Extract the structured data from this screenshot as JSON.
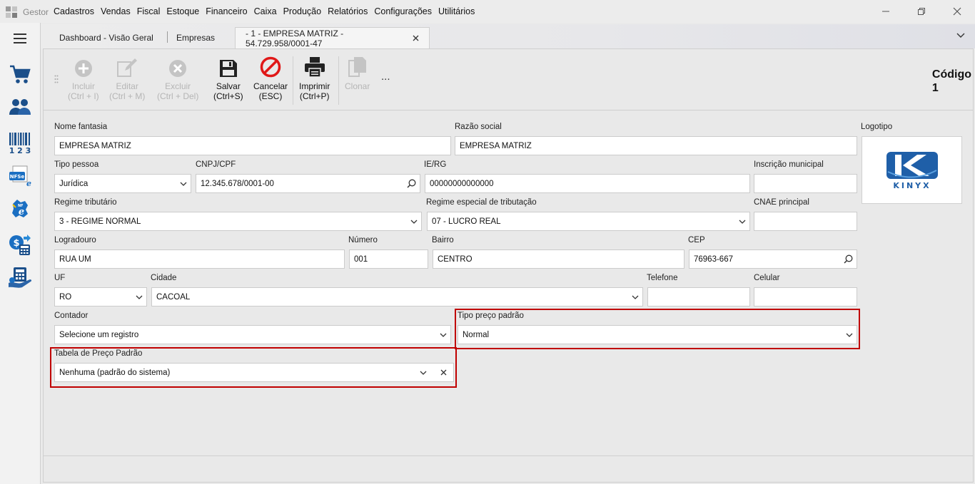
{
  "app": {
    "name": "Gestor"
  },
  "menu": [
    "Cadastros",
    "Vendas",
    "Fiscal",
    "Estoque",
    "Financeiro",
    "Caixa",
    "Produção",
    "Relatórios",
    "Configurações",
    "Utilitários"
  ],
  "tabs": [
    "Dashboard - Visão Geral",
    "Empresas",
    "- 1 - EMPRESA MATRIZ - 54.729.958/0001-47"
  ],
  "sidebar_icons": [
    "cart-icon",
    "people-icon",
    "barcode-icon",
    "nfse-icon",
    "nfe-icon",
    "cash-register-icon",
    "finance-icon"
  ],
  "toolbar": {
    "incluir": {
      "label": "Incluir",
      "shortcut": "(Ctrl + I)"
    },
    "editar": {
      "label": "Editar",
      "shortcut": "(Ctrl + M)"
    },
    "excluir": {
      "label": "Excluir",
      "shortcut": "(Ctrl + Del)"
    },
    "salvar": {
      "label": "Salvar",
      "shortcut": "(Ctrl+S)"
    },
    "cancelar": {
      "label": "Cancelar",
      "shortcut": "(ESC)"
    },
    "imprimir": {
      "label": "Imprimir",
      "shortcut": "(Ctrl+P)"
    },
    "clonar": {
      "label": "Clonar"
    },
    "more": "..."
  },
  "codigo": {
    "label": "Código",
    "value": "1"
  },
  "form": {
    "nome_fantasia": {
      "label": "Nome fantasia",
      "value": "EMPRESA MATRIZ"
    },
    "razao_social": {
      "label": "Razão social",
      "value": "EMPRESA MATRIZ"
    },
    "logotipo": {
      "label": "Logotipo",
      "brand": "KINYX"
    },
    "tipo_pessoa": {
      "label": "Tipo pessoa",
      "value": "Jurídica"
    },
    "cnpj": {
      "label": "CNPJ/CPF",
      "value": "12.345.678/0001-00"
    },
    "ie": {
      "label": "IE/RG",
      "value": "00000000000000"
    },
    "inscricao_municipal": {
      "label": "Inscrição municipal",
      "value": ""
    },
    "regime_tributario": {
      "label": "Regime tributário",
      "value": "3 - REGIME NORMAL"
    },
    "regime_especial": {
      "label": "Regime especial de tributação",
      "value": "07 - LUCRO REAL"
    },
    "cnae": {
      "label": "CNAE principal",
      "value": ""
    },
    "logradouro": {
      "label": "Logradouro",
      "value": "RUA UM"
    },
    "numero": {
      "label": "Número",
      "value": "001"
    },
    "bairro": {
      "label": "Bairro",
      "value": "CENTRO"
    },
    "cep": {
      "label": "CEP",
      "value": "76963-667"
    },
    "uf": {
      "label": "UF",
      "value": "RO"
    },
    "cidade": {
      "label": "Cidade",
      "value": "CACOAL"
    },
    "telefone": {
      "label": "Telefone",
      "value": ""
    },
    "celular": {
      "label": "Celular",
      "value": ""
    },
    "contador": {
      "label": "Contador",
      "value": "Selecione um registro"
    },
    "tipo_preco": {
      "label": "Tipo preço padrão",
      "value": "Normal"
    },
    "tabela_preco": {
      "label": "Tabela de Preço Padrão",
      "value": "Nenhuma (padrão do sistema)"
    }
  },
  "colors": {
    "highlight": "#c00000",
    "brand": "#1f5fa8"
  }
}
